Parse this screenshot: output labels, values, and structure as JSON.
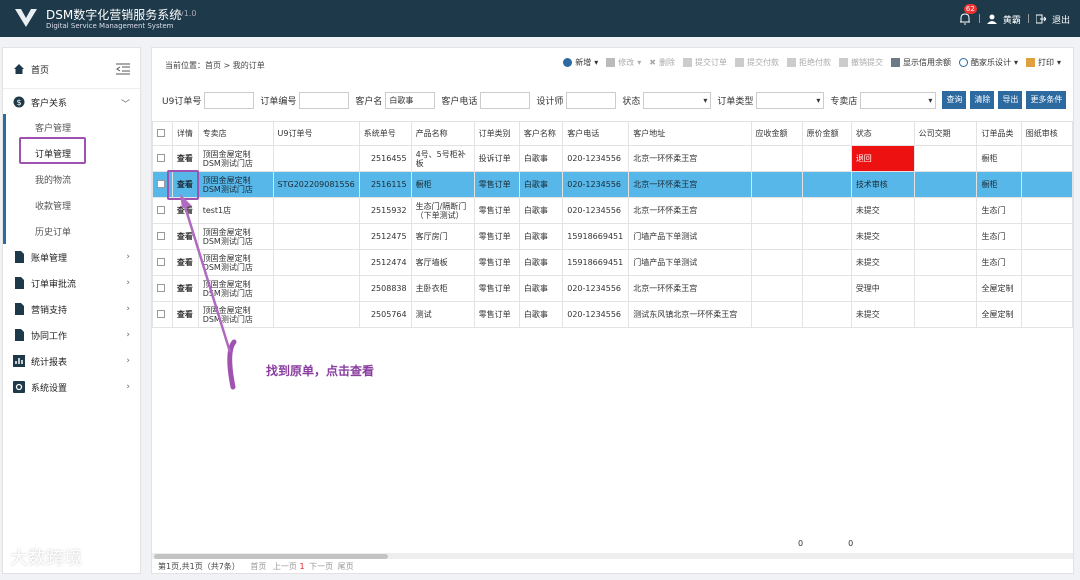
{
  "header": {
    "title": "DSM数字化营销服务系统",
    "version": "v1.0",
    "subtitle": "Digital Service Management System",
    "notif_count": "62",
    "user": "黄霸",
    "logout": "退出"
  },
  "sidebar": {
    "home": "首页",
    "customer_relations": "客户关系",
    "sub": [
      "客户管理",
      "订单管理",
      "我的物流",
      "收款管理",
      "历史订单"
    ],
    "groups": [
      "账单管理",
      "订单审批流",
      "营销支持",
      "协同工作",
      "统计报表",
      "系统设置"
    ]
  },
  "breadcrumb": "当前位置：首页 > 我的订单",
  "toolbar": [
    "新增",
    "修改",
    "删除",
    "提交订单",
    "提交付款",
    "拒绝付款",
    "撤销提交",
    "显示信用余额",
    "酷家乐设计",
    "打印"
  ],
  "filters": {
    "u9_label": "U9订单号",
    "order_no_label": "订单编号",
    "customer_name_label": "客户名",
    "customer_name_value": "白歌事",
    "phone_label": "客户电话",
    "designer_label": "设计师",
    "status_label": "状态",
    "order_type_label": "订单类型",
    "store_label": "专卖店",
    "btn_query": "查询",
    "btn_clear": "清除",
    "btn_export": "导出",
    "btn_more": "更多条件"
  },
  "table": {
    "headers": [
      "详情",
      "专卖店",
      "U9订单号",
      "系统单号",
      "产品名称",
      "订单类别",
      "客户名称",
      "客户电话",
      "客户地址",
      "应收金额",
      "原价金额",
      "状态",
      "公司交期",
      "订单品类",
      "图纸审核"
    ],
    "rows": [
      {
        "view": "查看",
        "store": "顶固金屋定制DSM测试门店",
        "u9": "",
        "sysno": "2516455",
        "product": "4号、5号柜补板",
        "category": "投诉订单",
        "customer": "白歌事",
        "phone": "020-1234556",
        "address": "北京一环怀柔王宫",
        "receivable": "",
        "original": "",
        "status": "退回",
        "delivery": "",
        "prodcat": "橱柜"
      },
      {
        "view": "查看",
        "store": "顶固金屋定制DSM测试门店",
        "u9": "STG202209081556",
        "sysno": "2516115",
        "product": "橱柜",
        "category": "零售订单",
        "customer": "白歌事",
        "phone": "020-1234556",
        "address": "北京一环怀柔王宫",
        "receivable": "",
        "original": "",
        "status": "技术审核",
        "delivery": "",
        "prodcat": "橱柜"
      },
      {
        "view": "查看",
        "store": "test1店",
        "u9": "",
        "sysno": "2515932",
        "product": "生态门/隔断门（下单测试）",
        "category": "零售订单",
        "customer": "白歌事",
        "phone": "020-1234556",
        "address": "北京一环怀柔王宫",
        "receivable": "",
        "original": "",
        "status": "未提交",
        "delivery": "",
        "prodcat": "生态门"
      },
      {
        "view": "查看",
        "store": "顶固金屋定制DSM测试门店",
        "u9": "",
        "sysno": "2512475",
        "product": "客厅房门",
        "category": "零售订单",
        "customer": "白歌事",
        "phone": "15918669451",
        "address": "门墙产品下单测试",
        "receivable": "",
        "original": "",
        "status": "未提交",
        "delivery": "",
        "prodcat": "生态门"
      },
      {
        "view": "查看",
        "store": "顶固金屋定制DSM测试门店",
        "u9": "",
        "sysno": "2512474",
        "product": "客厅墙板",
        "category": "零售订单",
        "customer": "白歌事",
        "phone": "15918669451",
        "address": "门墙产品下单测试",
        "receivable": "",
        "original": "",
        "status": "未提交",
        "delivery": "",
        "prodcat": "生态门"
      },
      {
        "view": "查看",
        "store": "顶固金屋定制DSM测试门店",
        "u9": "",
        "sysno": "2508838",
        "product": "主卧衣柜",
        "category": "零售订单",
        "customer": "白歌事",
        "phone": "020-1234556",
        "address": "北京一环怀柔王宫",
        "receivable": "",
        "original": "",
        "status": "受理中",
        "delivery": "",
        "prodcat": "全屋定制"
      },
      {
        "view": "查看",
        "store": "顶固金屋定制DSM测试门店",
        "u9": "",
        "sysno": "2505764",
        "product": "测试",
        "category": "零售订单",
        "customer": "白歌事",
        "phone": "020-1234556",
        "address": "测试东风镇北京一环怀柔王宫",
        "receivable": "",
        "original": "",
        "status": "未提交",
        "delivery": "",
        "prodcat": "全屋定制"
      }
    ],
    "totals": [
      "0",
      "0"
    ]
  },
  "pager": {
    "info": "第1页,共1页（共7条）",
    "first": "首页",
    "prev": "上一页",
    "current": "1",
    "next": "下一页",
    "last": "尾页"
  },
  "annotation": "找到原单，点击查看",
  "watermark": "大数跨境",
  "colors": {
    "accent": "#2c6aa0",
    "selected_row": "#57b7e8",
    "status_returned": "#ee1111",
    "annotation": "#a052b0"
  }
}
